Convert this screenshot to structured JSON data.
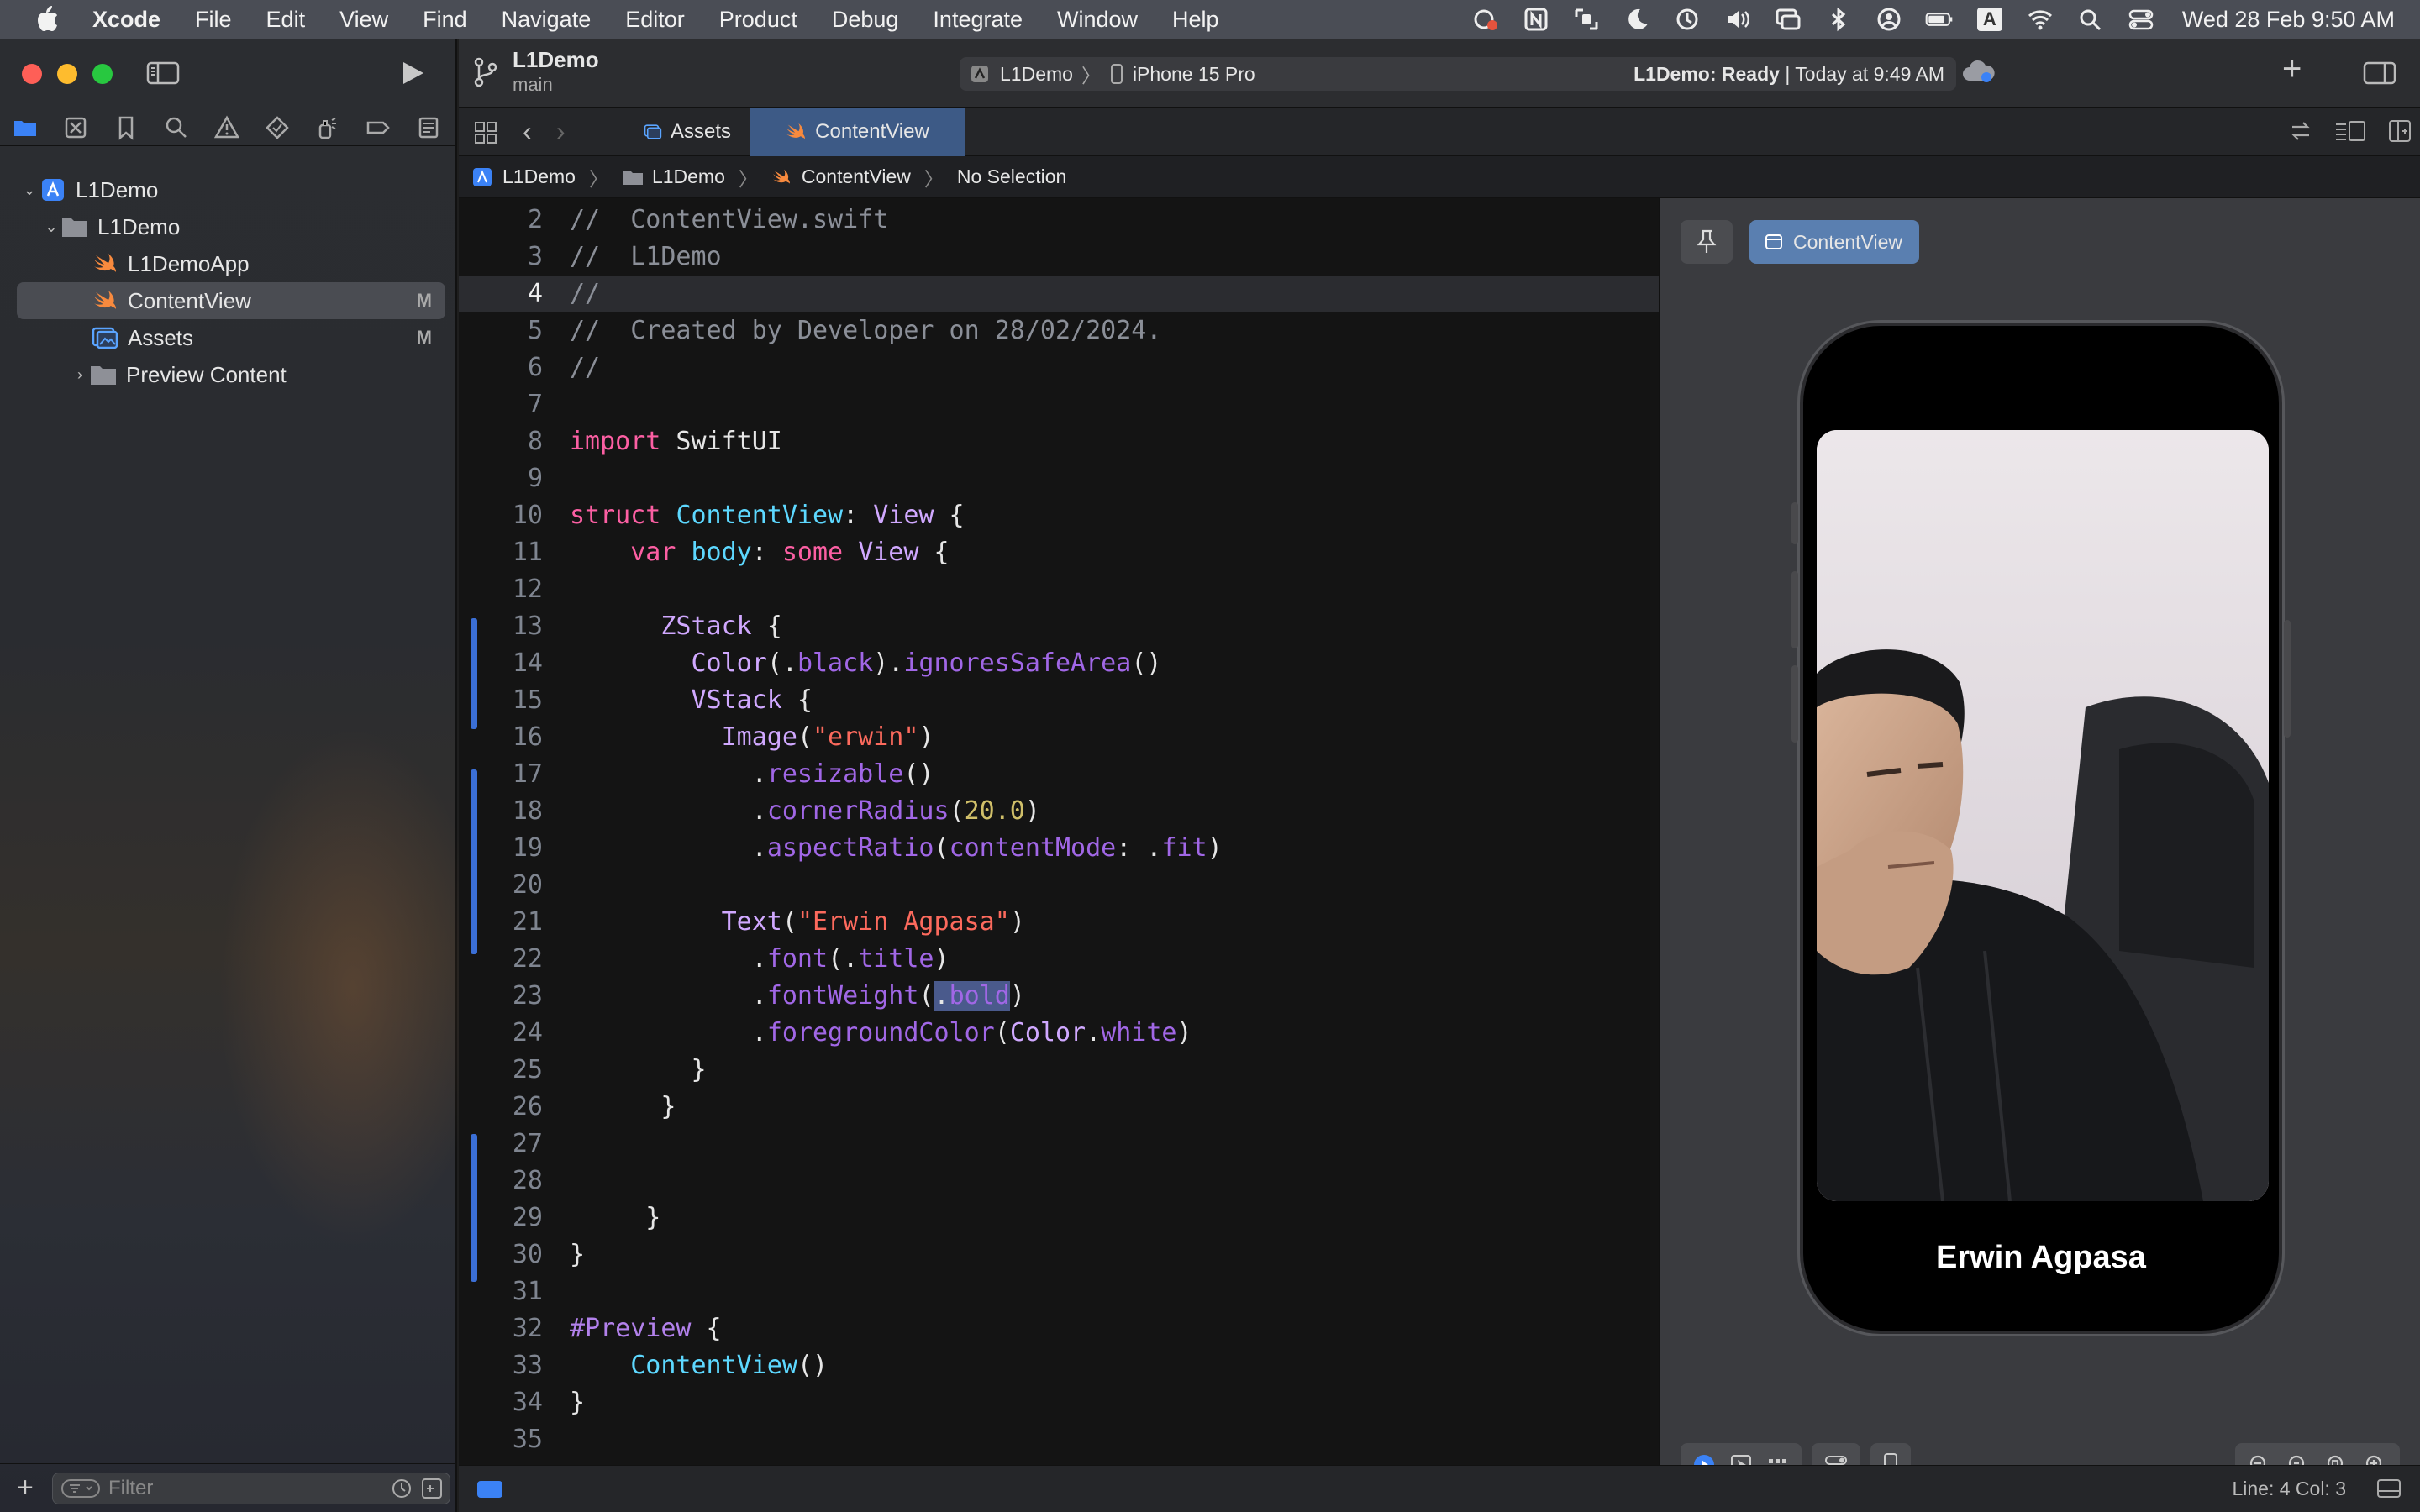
{
  "menubar": {
    "app": "Xcode",
    "items": [
      "File",
      "Edit",
      "View",
      "Find",
      "Navigate",
      "Editor",
      "Product",
      "Debug",
      "Integrate",
      "Window",
      "Help"
    ],
    "input_source": "A",
    "clock": "Wed 28 Feb  9:50 AM"
  },
  "toolbar": {
    "project": "L1Demo",
    "branch": "main",
    "scheme": "L1Demo",
    "destination": "iPhone 15 Pro",
    "status_bold": "L1Demo: Ready",
    "status_rest": " | Today at 9:49 AM"
  },
  "navigator": {
    "items": [
      {
        "label": "L1Demo",
        "icon": "project-icon"
      },
      {
        "label": "L1Demo",
        "icon": "folder-icon"
      },
      {
        "label": "L1DemoApp",
        "icon": "swift-file-icon"
      },
      {
        "label": "ContentView",
        "icon": "swift-file-icon",
        "badge": "M"
      },
      {
        "label": "Assets",
        "icon": "asset-catalog-icon",
        "badge": "M"
      },
      {
        "label": "Preview Content",
        "icon": "folder-icon"
      }
    ],
    "filter_placeholder": "Filter"
  },
  "tabs": {
    "assets": "Assets",
    "content": "ContentView"
  },
  "jumpbar": {
    "items": [
      "L1Demo",
      "L1Demo",
      "ContentView",
      "No Selection"
    ]
  },
  "code": {
    "line_numbers": [
      "2",
      "3",
      "4",
      "5",
      "6",
      "7",
      "8",
      "9",
      "10",
      "11",
      "12",
      "13",
      "14",
      "15",
      "16",
      "17",
      "18",
      "19",
      "20",
      "21",
      "22",
      "23",
      "24",
      "25",
      "26",
      "27",
      "28",
      "29",
      "30",
      "31",
      "32",
      "33",
      "34",
      "35"
    ]
  },
  "preview": {
    "chip": "ContentView",
    "name_text": "Erwin Agpasa"
  },
  "statusbar": {
    "position": "Line: 4  Col: 3"
  },
  "colors": {
    "accent": "#3b82f6",
    "tab_active": "#3d5a86",
    "keyword": "#fc5fa3",
    "string": "#fc6a5d",
    "number": "#d0bf69"
  }
}
